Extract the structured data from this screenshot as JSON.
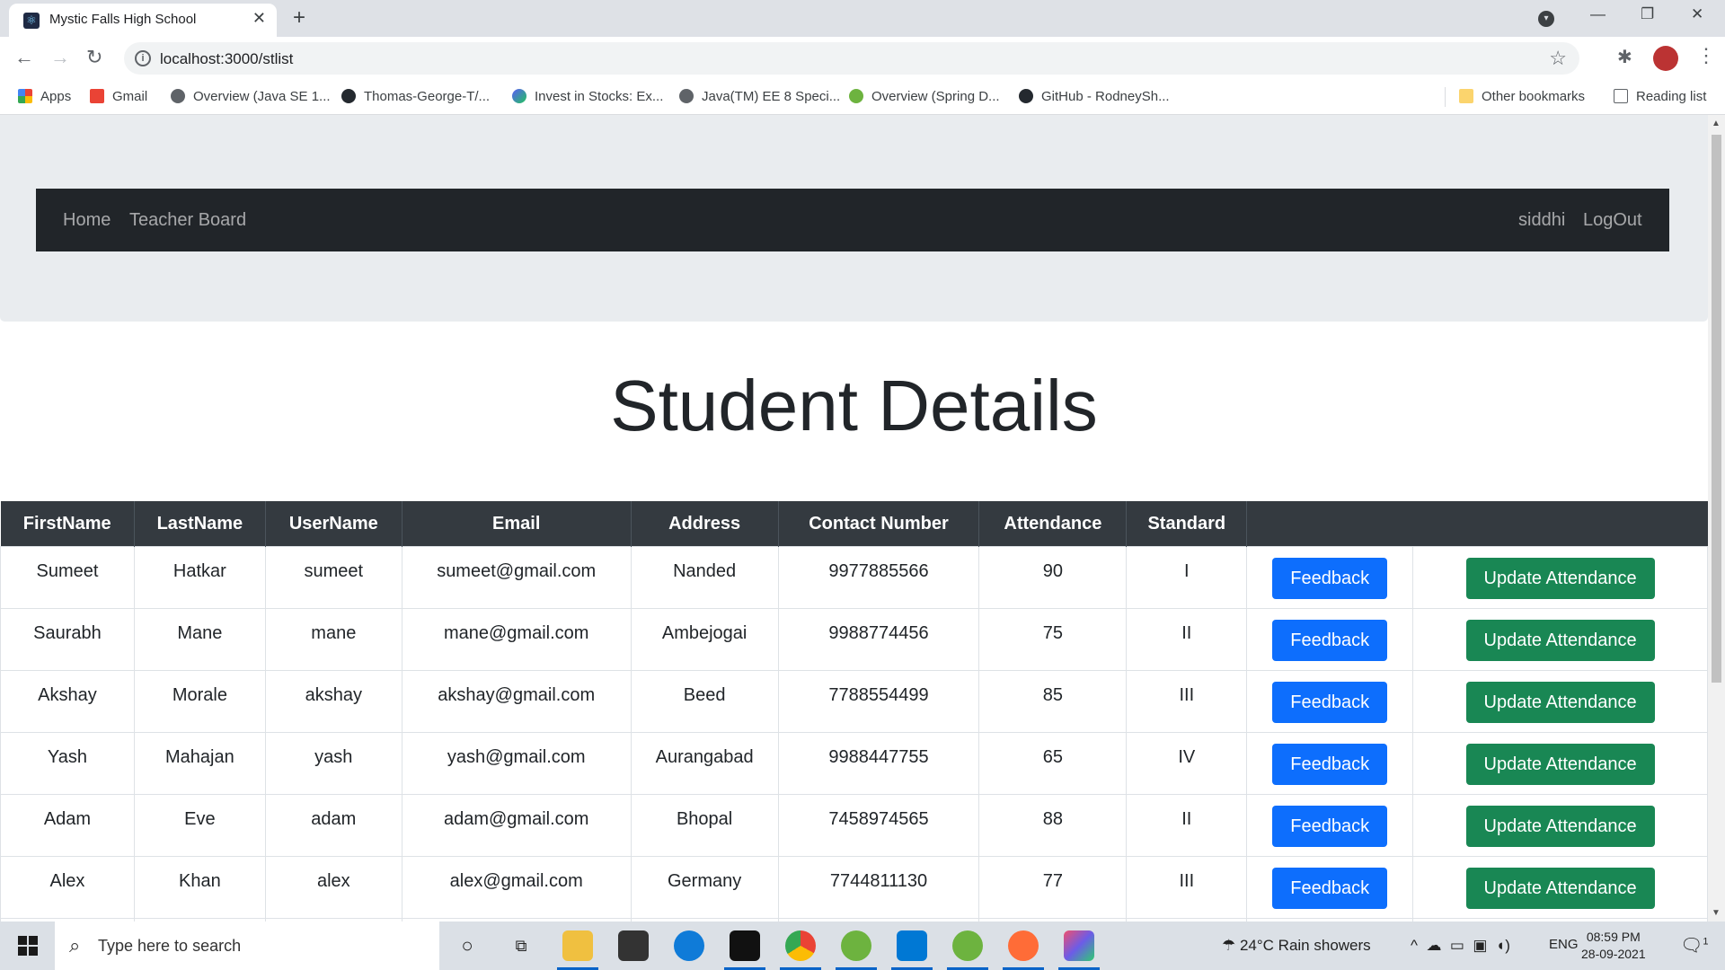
{
  "browser": {
    "tab_title": "Mystic Falls High School",
    "url": "localhost:3000/stlist",
    "bookmarks": [
      "Apps",
      "Gmail",
      "Overview (Java SE 1...",
      "Thomas-George-T/...",
      "Invest in Stocks: Ex...",
      "Java(TM) EE 8 Speci...",
      "Overview (Spring D...",
      "GitHub - RodneySh..."
    ],
    "other_bookmarks": "Other bookmarks",
    "reading_list": "Reading list"
  },
  "navbar": {
    "links": [
      "Home",
      "Teacher Board"
    ],
    "user": "siddhi",
    "logout": "LogOut"
  },
  "page": {
    "heading": "Student Details"
  },
  "table": {
    "headers": [
      "FirstName",
      "LastName",
      "UserName",
      "Email",
      "Address",
      "Contact Number",
      "Attendance",
      "Standard"
    ],
    "feedback_label": "Feedback",
    "update_label": "Update Attendance",
    "rows": [
      [
        "Sumeet",
        "Hatkar",
        "sumeet",
        "sumeet@gmail.com",
        "Nanded",
        "9977885566",
        "90",
        "I"
      ],
      [
        "Saurabh",
        "Mane",
        "mane",
        "mane@gmail.com",
        "Ambejogai",
        "9988774456",
        "75",
        "II"
      ],
      [
        "Akshay",
        "Morale",
        "akshay",
        "akshay@gmail.com",
        "Beed",
        "7788554499",
        "85",
        "III"
      ],
      [
        "Yash",
        "Mahajan",
        "yash",
        "yash@gmail.com",
        "Aurangabad",
        "9988447755",
        "65",
        "IV"
      ],
      [
        "Adam",
        "Eve",
        "adam",
        "adam@gmail.com",
        "Bhopal",
        "7458974565",
        "88",
        "II"
      ],
      [
        "Alex",
        "Khan",
        "alex",
        "alex@gmail.com",
        "Germany",
        "7744811130",
        "77",
        "III"
      ]
    ]
  },
  "taskbar": {
    "search_placeholder": "Type here to search",
    "weather": "24°C  Rain showers",
    "language": "ENG",
    "time": "08:59 PM",
    "date": "28-09-2021",
    "notification_count": "1"
  },
  "colors": {
    "navbar_bg": "#212529",
    "jumbotron_bg": "#e9ecef",
    "table_header_bg": "#343a40",
    "feedback_button": "#0d6efd",
    "update_button": "#198754"
  }
}
